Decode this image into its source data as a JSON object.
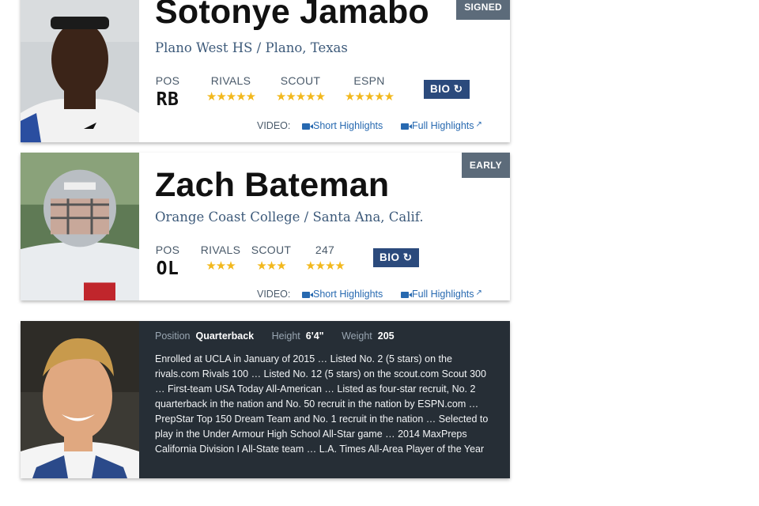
{
  "players": [
    {
      "name": "Sotonye Jamabo",
      "school": "Plano West HS / Plano, Texas",
      "badge": "SIGNED",
      "pos_label": "POS",
      "pos": "RB",
      "ratings": [
        {
          "source": "RIVALS",
          "stars": 5,
          "stars_text": "★★★★★"
        },
        {
          "source": "SCOUT",
          "stars": 5,
          "stars_text": "★★★★★"
        },
        {
          "source": "ESPN",
          "stars": 5,
          "stars_text": "★★★★★"
        }
      ],
      "bio_button": "BIO",
      "bio_icon": "refresh-icon",
      "video_label": "VIDEO:",
      "short_highlights": "Short Highlights",
      "full_highlights": "Full Highlights"
    },
    {
      "name": "Zach Bateman",
      "school": "Orange Coast College / Santa Ana, Calif.",
      "badge": "EARLY",
      "pos_label": "POS",
      "pos": "OL",
      "ratings": [
        {
          "source": "RIVALS",
          "stars": 3,
          "stars_text": "★★★"
        },
        {
          "source": "SCOUT",
          "stars": 3,
          "stars_text": "★★★"
        },
        {
          "source": "247",
          "stars": 4,
          "stars_text": "★★★★"
        }
      ],
      "bio_button": "BIO",
      "bio_icon": "refresh-icon",
      "video_label": "VIDEO:",
      "short_highlights": "Short Highlights",
      "full_highlights": "Full Highlights"
    },
    {
      "position_label": "Position",
      "position": "Quarterback",
      "height_label": "Height",
      "height": "6'4\"",
      "weight_label": "Weight",
      "weight": "205",
      "bio": "Enrolled at UCLA in January of 2015 … Listed No. 2 (5 stars) on the rivals.com Rivals 100 … Listed No. 12 (5 stars) on the scout.com Scout 300 … First-team USA Today All-American … Listed as four-star recruit, No. 2 quarterback in the nation and No. 50 recruit in the nation by ESPN.com … PrepStar Top 150 Dream Team and No. 1 recruit in the nation … Selected to play in the Under Armour High School All-Star game … 2014 MaxPreps California Division I All-State team … L.A. Times All-Area Player of the Year"
    }
  ],
  "icons": {
    "video": "video-camera-icon",
    "external": "external-link-icon"
  },
  "colors": {
    "badge": "#5c6b7a",
    "bio_button": "#2b4a7c",
    "star": "#f2b81d",
    "link": "#2769b0",
    "dark_card": "#262e36"
  }
}
